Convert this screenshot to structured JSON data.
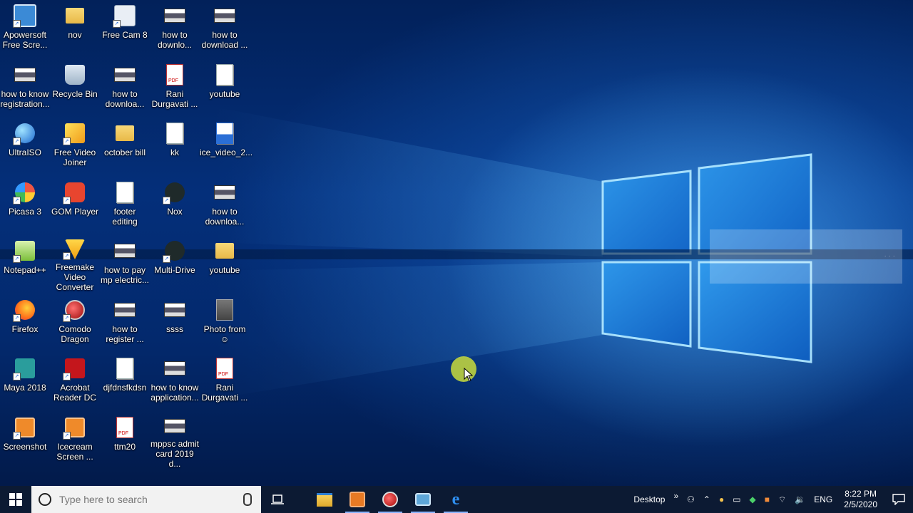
{
  "desktop": {
    "icons": [
      {
        "label": "Apowersoft\nFree Scre...",
        "icon": "apowersoft-icon"
      },
      {
        "label": "nov",
        "icon": "zip-folder-icon"
      },
      {
        "label": "Free Cam 8",
        "icon": "freecam-icon"
      },
      {
        "label": "how to\ndownlo...",
        "icon": "image-file-icon"
      },
      {
        "label": "how to\ndownload ...",
        "icon": "image-file-icon"
      },
      {
        "label": "how to know\nregistration...",
        "icon": "image-file-icon"
      },
      {
        "label": "Recycle Bin",
        "icon": "recycle-bin-icon"
      },
      {
        "label": "how to\ndownloa...",
        "icon": "image-file-icon"
      },
      {
        "label": "Rani\nDurgavati ...",
        "icon": "pdf-file-icon"
      },
      {
        "label": "youtube",
        "icon": "text-file-icon"
      },
      {
        "label": "UltraISO",
        "icon": "ultraiso-icon"
      },
      {
        "label": "Free Video\nJoiner",
        "icon": "video-joiner-icon"
      },
      {
        "label": "october bill",
        "icon": "zip-folder-icon"
      },
      {
        "label": "kk",
        "icon": "text-file-icon"
      },
      {
        "label": "ice_video_2...",
        "icon": "video-file-icon"
      },
      {
        "label": "Picasa 3",
        "icon": "picasa-icon"
      },
      {
        "label": "GOM Player",
        "icon": "gom-player-icon"
      },
      {
        "label": "footer\nediting",
        "icon": "text-file-icon"
      },
      {
        "label": "Nox",
        "icon": "nox-icon"
      },
      {
        "label": "how to\ndownloa...",
        "icon": "image-file-icon"
      },
      {
        "label": "Notepad++",
        "icon": "notepad-plus-icon"
      },
      {
        "label": "Freemake\nVideo\nConverter",
        "icon": "freemake-icon"
      },
      {
        "label": "how to pay\nmp electric...",
        "icon": "image-file-icon"
      },
      {
        "label": "Multi-Drive",
        "icon": "nox-icon"
      },
      {
        "label": "youtube",
        "icon": "zip-folder-icon"
      },
      {
        "label": "Firefox",
        "icon": "firefox-icon"
      },
      {
        "label": "Comodo\nDragon",
        "icon": "comodo-dragon-icon"
      },
      {
        "label": "how to\nregister ...",
        "icon": "image-file-icon"
      },
      {
        "label": "ssss",
        "icon": "image-file-icon"
      },
      {
        "label": "Photo from\n☺",
        "icon": "photo-file-icon"
      },
      {
        "label": "Maya 2018",
        "icon": "maya-icon"
      },
      {
        "label": "Acrobat\nReader DC",
        "icon": "acrobat-icon"
      },
      {
        "label": "djfdnsfkdsn",
        "icon": "text-file-icon"
      },
      {
        "label": "how to know\napplication...",
        "icon": "image-file-icon"
      },
      {
        "label": "Rani\nDurgavati ...",
        "icon": "pdf-file-icon"
      },
      {
        "label": "Screenshot",
        "icon": "screenshot-icon"
      },
      {
        "label": "Icecream\nScreen ...",
        "icon": "icecream-icon"
      },
      {
        "label": "ttm20",
        "icon": "pdf-file-icon"
      },
      {
        "label": "mppsc admit\ncard 2019 d...",
        "icon": "image-file-icon"
      }
    ]
  },
  "taskbar": {
    "search_placeholder": "Type here to search",
    "apps": [
      {
        "name": "task-view-icon"
      },
      {
        "name": "file-explorer-icon"
      },
      {
        "name": "icecream-taskbar-icon"
      },
      {
        "name": "comodo-dragon-taskbar-icon"
      },
      {
        "name": "freecam-taskbar-icon"
      },
      {
        "name": "edge-icon"
      }
    ],
    "desktop_label": "Desktop",
    "chevron": "»",
    "language": "ENG",
    "time": "8:22 PM",
    "date": "2/5/2020"
  },
  "colors": {
    "taskbar": "#0c1a33",
    "desktop_dark": "#02215a",
    "logo_glow": "#8fd8ff"
  }
}
